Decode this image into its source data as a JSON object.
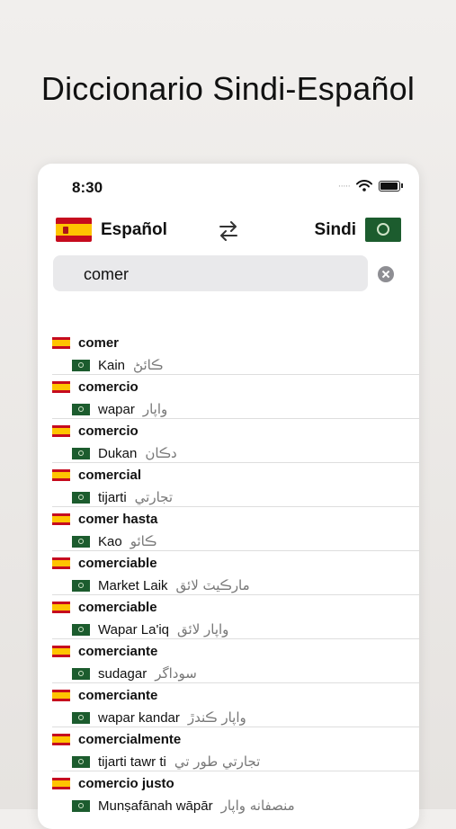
{
  "headline": "Diccionario Sindi-Español",
  "status": {
    "time": "8:30",
    "dots": "·····"
  },
  "languages": {
    "source": "Español",
    "target": "Sindi"
  },
  "search": {
    "value": "comer",
    "placeholder": ""
  },
  "results": [
    {
      "es": "comer",
      "sd_latin": "Kain",
      "sd_arabic": "ڪائڻ"
    },
    {
      "es": "comercio",
      "sd_latin": "wapar",
      "sd_arabic": "واپار"
    },
    {
      "es": "comercio",
      "sd_latin": "Dukan",
      "sd_arabic": "دڪان"
    },
    {
      "es": "comercial",
      "sd_latin": "tijarti",
      "sd_arabic": "تجارتي"
    },
    {
      "es": "comer hasta",
      "sd_latin": "Kao",
      "sd_arabic": "ڪائو"
    },
    {
      "es": "comerciable",
      "sd_latin": "Market Laik",
      "sd_arabic": "مارڪيٽ لائق"
    },
    {
      "es": "comerciable",
      "sd_latin": "Wapar La'iq",
      "sd_arabic": "واپار لائق"
    },
    {
      "es": "comerciante",
      "sd_latin": "sudagar",
      "sd_arabic": "سوداگر"
    },
    {
      "es": "comerciante",
      "sd_latin": "wapar kandar",
      "sd_arabic": "واپار ڪندڙ"
    },
    {
      "es": "comercialmente",
      "sd_latin": "tijarti tawr ti",
      "sd_arabic": "تجارتي طور تي"
    },
    {
      "es": "comercio justo",
      "sd_latin": "Munṣafānah wāpār",
      "sd_arabic": "منصفانه واپار"
    }
  ]
}
